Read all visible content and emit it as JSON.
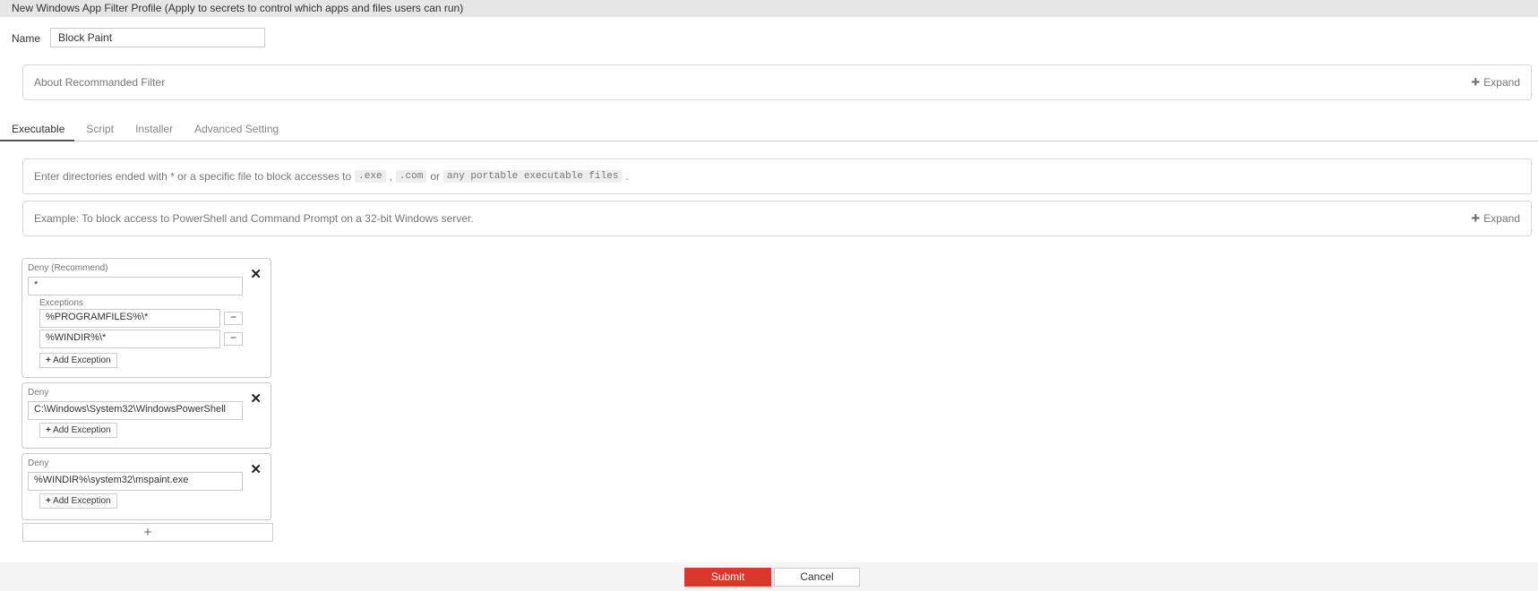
{
  "header": {
    "title": "New Windows App Filter Profile (Apply to secrets to control which apps and files users can run)"
  },
  "name": {
    "label": "Name",
    "value": "Block Paint"
  },
  "about": {
    "text": "About Recommanded Filter",
    "expand": "Expand"
  },
  "tabs": [
    {
      "label": "Executable",
      "active": true
    },
    {
      "label": "Script"
    },
    {
      "label": "Installer"
    },
    {
      "label": "Advanced Setting"
    }
  ],
  "info": {
    "text": "Enter directories ended with * or a specific file to block accesses to",
    "code1": ".exe",
    "sep1": ",",
    "code2": ".com",
    "or": "or",
    "code3": "any portable executable files",
    "end": "."
  },
  "example": {
    "text": "Example: To block access to PowerShell and Command Prompt on a 32-bit Windows server.",
    "expand": "Expand"
  },
  "rules": [
    {
      "label": "Deny (Recommend)",
      "value": "*",
      "exceptions_label": "Exceptions",
      "exceptions": [
        "%PROGRAMFILES%\\*",
        "%WINDIR%\\*"
      ],
      "add": "Add Exception"
    },
    {
      "label": "Deny",
      "value": "C:\\Windows\\System32\\WindowsPowerShell",
      "add": "Add Exception"
    },
    {
      "label": "Deny",
      "value": "%WINDIR%\\system32\\mspaint.exe",
      "add": "Add Exception"
    }
  ],
  "buttons": {
    "submit": "Submit",
    "cancel": "Cancel"
  },
  "colors": {
    "submit": "#d9372a",
    "header": "#e6e6e6"
  }
}
